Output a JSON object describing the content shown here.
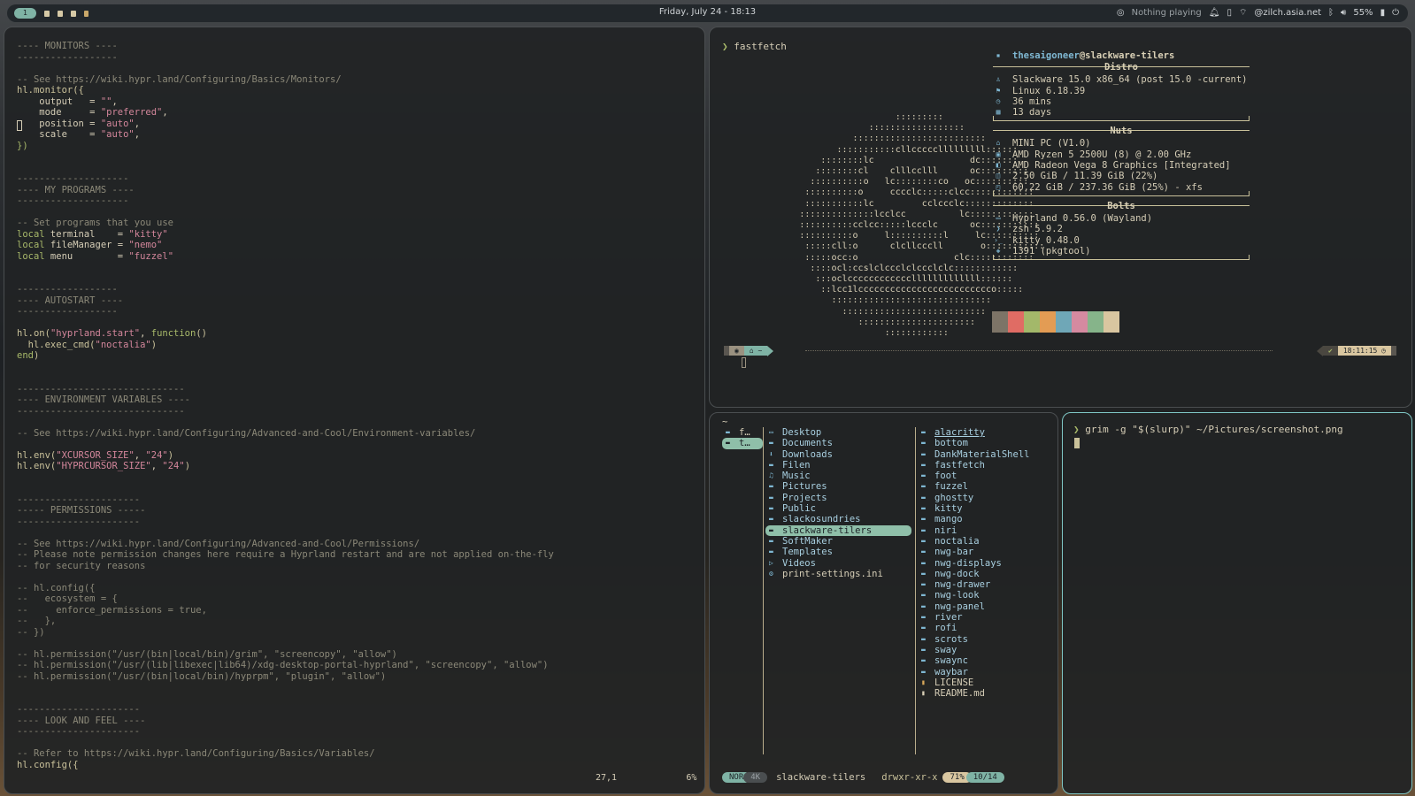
{
  "bar": {
    "workspace": "1",
    "datetime": "Friday, July 24 - 18:13",
    "media": "Nothing playing",
    "network": "@zilch.asia.net",
    "volume": "55%"
  },
  "colors": {
    "accent": "#7fb3a5",
    "focus_border": "#7fc6c4"
  },
  "nvim": {
    "lines": [
      [
        {
          "t": "---- MONITORS ----",
          "c": "c"
        }
      ],
      [
        {
          "t": "------------------",
          "c": "c"
        }
      ],
      [],
      [
        {
          "t": "-- See https://wiki.hypr.land/Configuring/Basics/Monitors/",
          "c": "c"
        }
      ],
      [
        {
          "t": "hl.monitor({",
          "c": "f"
        }
      ],
      [
        {
          "t": "    output   = ",
          "c": ""
        },
        {
          "t": "\"\"",
          "c": "s"
        },
        {
          "t": ",",
          "c": ""
        }
      ],
      [
        {
          "t": "    mode     = ",
          "c": ""
        },
        {
          "t": "\"preferred\"",
          "c": "s"
        },
        {
          "t": ",",
          "c": ""
        }
      ],
      [
        {
          "t": "    position = ",
          "c": ""
        },
        {
          "t": "\"auto\"",
          "c": "s"
        },
        {
          "t": ",",
          "c": ""
        }
      ],
      [
        {
          "t": "    scale    = ",
          "c": ""
        },
        {
          "t": "\"auto\"",
          "c": "s"
        },
        {
          "t": ",",
          "c": ""
        }
      ],
      [
        {
          "t": "})",
          "c": "k"
        }
      ],
      [],
      [],
      [
        {
          "t": "--------------------",
          "c": "c"
        }
      ],
      [
        {
          "t": "---- MY PROGRAMS ----",
          "c": "c"
        }
      ],
      [
        {
          "t": "--------------------",
          "c": "c"
        }
      ],
      [],
      [
        {
          "t": "-- Set programs that you use",
          "c": "c"
        }
      ],
      [
        {
          "t": "local",
          "c": "k"
        },
        {
          "t": " terminal    = ",
          "c": ""
        },
        {
          "t": "\"kitty\"",
          "c": "s"
        }
      ],
      [
        {
          "t": "local",
          "c": "k"
        },
        {
          "t": " fileManager = ",
          "c": ""
        },
        {
          "t": "\"nemo\"",
          "c": "s"
        }
      ],
      [
        {
          "t": "local",
          "c": "k"
        },
        {
          "t": " menu        = ",
          "c": ""
        },
        {
          "t": "\"fuzzel\"",
          "c": "s"
        }
      ],
      [],
      [],
      [
        {
          "t": "------------------",
          "c": "c"
        }
      ],
      [
        {
          "t": "---- AUTOSTART ----",
          "c": "c"
        }
      ],
      [
        {
          "t": "------------------",
          "c": "c"
        }
      ],
      [],
      [
        {
          "t": "hl.on(",
          "c": "f"
        },
        {
          "t": "\"hyprland.start\"",
          "c": "s"
        },
        {
          "t": ", ",
          "c": ""
        },
        {
          "t": "function",
          "c": "k"
        },
        {
          "t": "()",
          "c": "f"
        }
      ],
      [
        {
          "t": "  hl.exec_cmd(",
          "c": "f"
        },
        {
          "t": "\"noctalia\"",
          "c": "s"
        },
        {
          "t": ")",
          "c": "f"
        }
      ],
      [
        {
          "t": "end",
          "c": "k"
        },
        {
          "t": ")",
          "c": "f"
        }
      ],
      [],
      [],
      [
        {
          "t": "------------------------------",
          "c": "c"
        }
      ],
      [
        {
          "t": "---- ENVIRONMENT VARIABLES ----",
          "c": "c"
        }
      ],
      [
        {
          "t": "------------------------------",
          "c": "c"
        }
      ],
      [],
      [
        {
          "t": "-- See https://wiki.hypr.land/Configuring/Advanced-and-Cool/Environment-variables/",
          "c": "c"
        }
      ],
      [],
      [
        {
          "t": "hl.env(",
          "c": "f"
        },
        {
          "t": "\"XCURSOR_SIZE\"",
          "c": "s"
        },
        {
          "t": ", ",
          "c": ""
        },
        {
          "t": "\"24\"",
          "c": "s"
        },
        {
          "t": ")",
          "c": "f"
        }
      ],
      [
        {
          "t": "hl.env(",
          "c": "f"
        },
        {
          "t": "\"HYPRCURSOR_SIZE\"",
          "c": "s"
        },
        {
          "t": ", ",
          "c": ""
        },
        {
          "t": "\"24\"",
          "c": "s"
        },
        {
          "t": ")",
          "c": "f"
        }
      ],
      [],
      [],
      [
        {
          "t": "----------------------",
          "c": "c"
        }
      ],
      [
        {
          "t": "----- PERMISSIONS -----",
          "c": "c"
        }
      ],
      [
        {
          "t": "----------------------",
          "c": "c"
        }
      ],
      [],
      [
        {
          "t": "-- See https://wiki.hypr.land/Configuring/Advanced-and-Cool/Permissions/",
          "c": "c"
        }
      ],
      [
        {
          "t": "-- Please note permission changes here require a Hyprland restart and are not applied on-the-fly",
          "c": "c"
        }
      ],
      [
        {
          "t": "-- for security reasons",
          "c": "c"
        }
      ],
      [],
      [
        {
          "t": "-- hl.config({",
          "c": "c"
        }
      ],
      [
        {
          "t": "--   ecosystem = {",
          "c": "c"
        }
      ],
      [
        {
          "t": "--     enforce_permissions = true,",
          "c": "c"
        }
      ],
      [
        {
          "t": "--   },",
          "c": "c"
        }
      ],
      [
        {
          "t": "-- })",
          "c": "c"
        }
      ],
      [],
      [
        {
          "t": "-- hl.permission(\"/usr/(bin|local/bin)/grim\", \"screencopy\", \"allow\")",
          "c": "c"
        }
      ],
      [
        {
          "t": "-- hl.permission(\"/usr/(lib|libexec|lib64)/xdg-desktop-portal-hyprland\", \"screencopy\", \"allow\")",
          "c": "c"
        }
      ],
      [
        {
          "t": "-- hl.permission(\"/usr/(bin|local/bin)/hyprpm\", \"plugin\", \"allow\")",
          "c": "c"
        }
      ],
      [],
      [],
      [
        {
          "t": "----------------------",
          "c": "c"
        }
      ],
      [
        {
          "t": "---- LOOK AND FEEL ----",
          "c": "c"
        }
      ],
      [
        {
          "t": "----------------------",
          "c": "c"
        }
      ],
      [],
      [
        {
          "t": "-- Refer to https://wiki.hypr.land/Configuring/Basics/Variables/",
          "c": "c"
        }
      ],
      [
        {
          "t": "hl.config({",
          "c": "f"
        }
      ]
    ],
    "cursor_pos": "27,1",
    "scroll_pct": "6%"
  },
  "fastfetch": {
    "command": "fastfetch",
    "logo": [
      "                                  :::::::::",
      "                             ::::::::::::::::::",
      "                          :::::::::::::::::::::::::",
      "                       :::::::::::cllccccclllllllll::::::",
      "                    ::::::::lc                  dc:::::::",
      "                   ::::::::cl    clllcclll      oc:::::::::",
      "                  ::::::::::o   lc::::::::co   oc::::::::::",
      "                 ::::::::::o     cccclc:::::clcc::::::::::::",
      "                 :::::::::::lc         cclccclc:::::::::::::",
      "                ::::::::::::::lcclcc          lc::::::::::::",
      "                ::::::::::cclcc:::::lccclc      oc:::::::::::",
      "                ::::::::::o     l::::::::::l     lc::::::::::",
      "                 :::::cll:o      clcllcccll       o:::::::::::",
      "                 :::::occ:o                  clc::::::::::::",
      "                  ::::ocl:ccslclccclclccclclc::::::::::::",
      "                   :::oclcccccccccccclllllllllllll::::::",
      "                    ::lcc1lccccccccccccccccccccccccco:::::",
      "                      ::::::::::::::::::::::::::::::",
      "                        :::::::::::::::::::::::::::",
      "                           ::::::::::::::::::::::",
      "                                ::::::::::::"
    ],
    "user": "thesaigoneer",
    "host": "@slackware-tilers",
    "sections": [
      {
        "title": "Distro",
        "items": [
          "Slackware 15.0 x86_64 (post 15.0 -current)",
          "Linux 6.18.39",
          "36 mins",
          "13 days"
        ],
        "icons": [
          "penguin-icon",
          "linux-icon",
          "clock-icon",
          "calendar-icon"
        ]
      },
      {
        "title": "Nuts",
        "items": [
          "MINI PC (V1.0)",
          "AMD Ryzen 5 2500U (8) @ 2.00 GHz",
          "AMD Radeon Vega 8 Graphics [Integrated]",
          "2.50 GiB / 11.39 GiB (22%)",
          "60.22 GiB / 237.36 GiB (25%) - xfs"
        ],
        "icons": [
          "home-icon",
          "cpu-icon",
          "gpu-icon",
          "memory-icon",
          "disk-icon"
        ]
      },
      {
        "title": "Bolts",
        "items": [
          "Hyprland 0.56.0 (Wayland)",
          "zsh 5.9.2",
          "kitty 0.48.0",
          "1391 (pkgtool)"
        ],
        "icons": [
          "window-icon",
          "shell-icon",
          "terminal-icon",
          "package-icon"
        ]
      }
    ],
    "palette": [
      "#7d7467",
      "#e06c64",
      "#a3b86a",
      "#e39c54",
      "#6fa7b7",
      "#d58aa0",
      "#86b48a",
      "#d9c6a0"
    ],
    "prompt_home": "~",
    "prompt_time": "18:11:15"
  },
  "yazi": {
    "path": "~",
    "parents": [
      "f…",
      "t…"
    ],
    "current": [
      {
        "name": "Desktop",
        "icon": "desktop-icon"
      },
      {
        "name": "Documents",
        "icon": "folder-icon"
      },
      {
        "name": "Downloads",
        "icon": "download-icon"
      },
      {
        "name": "Filen",
        "icon": "folder-icon"
      },
      {
        "name": "Music",
        "icon": "music-icon"
      },
      {
        "name": "Pictures",
        "icon": "folder-icon"
      },
      {
        "name": "Projects",
        "icon": "folder-icon"
      },
      {
        "name": "Public",
        "icon": "folder-icon"
      },
      {
        "name": "slackosundries",
        "icon": "folder-icon"
      },
      {
        "name": "slackware-tilers",
        "icon": "folder-icon",
        "selected": true
      },
      {
        "name": "SoftMaker",
        "icon": "folder-icon"
      },
      {
        "name": "Templates",
        "icon": "folder-icon"
      },
      {
        "name": "Videos",
        "icon": "video-icon"
      },
      {
        "name": "print-settings.ini",
        "icon": "gear-icon",
        "file": true
      }
    ],
    "preview": [
      "alacritty",
      "bottom",
      "DankMaterialShell",
      "fastfetch",
      "foot",
      "fuzzel",
      "ghostty",
      "kitty",
      "mango",
      "niri",
      "noctalia",
      "nwg-bar",
      "nwg-displays",
      "nwg-dock",
      "nwg-drawer",
      "nwg-look",
      "nwg-panel",
      "river",
      "rofi",
      "scrots",
      "sway",
      "swaync",
      "waybar",
      "LICENSE",
      "README.md"
    ],
    "mode": "NOR",
    "size": "4K",
    "status_name": "slackware-tilers",
    "perms": "drwxr-xr-x",
    "pct": "71%",
    "position": "10/14"
  },
  "terminal": {
    "command": "grim -g \"$(slurp)\" ~/Pictures/screenshot.png"
  }
}
